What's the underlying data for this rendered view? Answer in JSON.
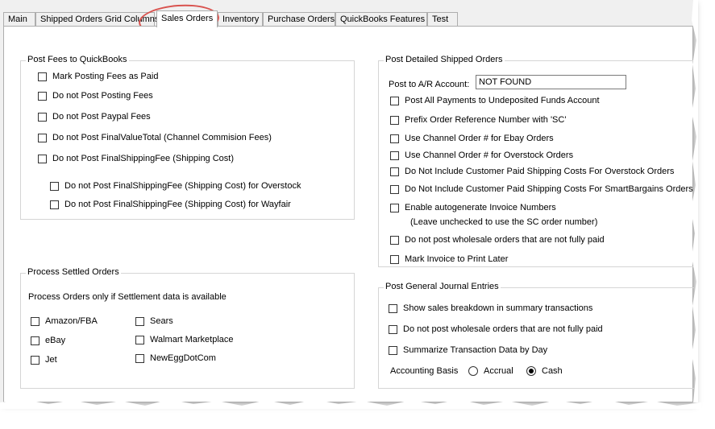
{
  "tabs": [
    {
      "label": "Main"
    },
    {
      "label": "Shipped Orders Grid Columns"
    },
    {
      "label": "Sales Orders"
    },
    {
      "label": "Inventory"
    },
    {
      "label": "Purchase Orders"
    },
    {
      "label": "QuickBooks Features"
    },
    {
      "label": "Test"
    }
  ],
  "active_tab": "Sales Orders",
  "post_fees": {
    "title": "Post Fees to QuickBooks",
    "items": [
      {
        "label": "Mark Posting Fees as Paid",
        "checked": false
      },
      {
        "label": "Do not Post Posting Fees",
        "checked": false
      },
      {
        "label": "Do not Post Paypal Fees",
        "checked": false
      },
      {
        "label": "Do not Post FinalValueTotal (Channel Commision Fees)",
        "checked": false
      },
      {
        "label": "Do not Post FinalShippingFee (Shipping Cost)",
        "checked": false
      },
      {
        "label": "Do not Post FinalShippingFee (Shipping Cost) for Overstock",
        "checked": false
      },
      {
        "label": "Do not Post FinalShippingFee (Shipping Cost) for Wayfair",
        "checked": false
      }
    ]
  },
  "settled": {
    "title": "Process Settled Orders",
    "note": "Process Orders only if Settlement data is available",
    "col1": [
      {
        "label": "Amazon/FBA",
        "checked": false
      },
      {
        "label": "eBay",
        "checked": false
      },
      {
        "label": "Jet",
        "checked": false
      }
    ],
    "col2": [
      {
        "label": "Sears",
        "checked": false
      },
      {
        "label": "Walmart Marketplace",
        "checked": false
      },
      {
        "label": "NewEggDotCom",
        "checked": false
      }
    ]
  },
  "detailed": {
    "title": "Post Detailed Shipped Orders",
    "ar_label": "Post to A/R Account:",
    "ar_value": "NOT FOUND",
    "items": [
      {
        "label": "Post All Payments to Undeposited Funds Account",
        "checked": false
      },
      {
        "label": "Prefix Order Reference Number with 'SC'",
        "checked": false
      },
      {
        "label": "Use Channel Order # for Ebay Orders",
        "checked": false
      },
      {
        "label": "Use Channel Order # for Overstock Orders",
        "checked": false
      },
      {
        "label": "Do Not Include Customer Paid Shipping Costs For Overstock Orders",
        "checked": false
      },
      {
        "label": "Do Not Include Customer Paid Shipping Costs For SmartBargains Orders",
        "checked": false
      },
      {
        "label": "Enable autogenerate Invoice Numbers",
        "checked": false
      },
      {
        "label": "Do not post wholesale orders that are not fully paid",
        "checked": false
      },
      {
        "label": "Mark Invoice to Print Later",
        "checked": false
      }
    ],
    "autogen_note": "(Leave unchecked to use the SC order number)"
  },
  "journal": {
    "title": "Post General Journal Entries",
    "items": [
      {
        "label": "Show sales breakdown in summary transactions",
        "checked": false
      },
      {
        "label": "Do not post wholesale orders that are not fully paid",
        "checked": false
      },
      {
        "label": "Summarize Transaction Data by Day",
        "checked": false
      }
    ],
    "basis_label": "Accounting Basis",
    "basis_options": [
      {
        "label": "Accrual",
        "selected": false
      },
      {
        "label": "Cash",
        "selected": true
      }
    ]
  }
}
